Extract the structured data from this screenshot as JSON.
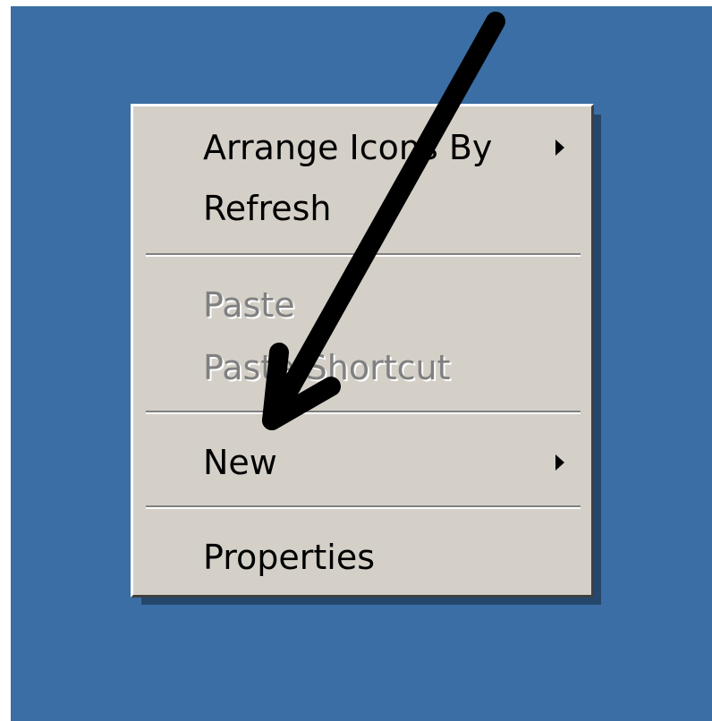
{
  "desktop": {
    "background_color": "#3a6ea5"
  },
  "context_menu": {
    "items": [
      {
        "label": "Arrange Icons By",
        "enabled": true,
        "has_submenu": true
      },
      {
        "label": "Refresh",
        "enabled": true,
        "has_submenu": false
      },
      {
        "label": "Paste",
        "enabled": false,
        "has_submenu": false
      },
      {
        "label": "Paste Shortcut",
        "enabled": false,
        "has_submenu": false
      },
      {
        "label": "New",
        "enabled": true,
        "has_submenu": true
      },
      {
        "label": "Properties",
        "enabled": true,
        "has_submenu": false
      }
    ],
    "submenu_icon": "submenu-arrow-icon",
    "colors": {
      "menu_background": "#d4d0c8",
      "disabled_text": "#808080",
      "text": "#000000"
    }
  },
  "annotation": {
    "icon": "pointer-arrow-icon",
    "points_to": "New",
    "color": "#000000"
  }
}
